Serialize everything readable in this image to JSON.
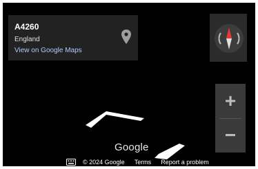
{
  "info_card": {
    "title": "A4260",
    "subtitle": "England",
    "link": "View on Google Maps",
    "pin_icon": "map-pin-icon"
  },
  "compass": {
    "icon": "compass-icon"
  },
  "zoom": {
    "in_label": "+",
    "out_label": "−"
  },
  "logo": {
    "text": "Google"
  },
  "footer": {
    "keyboard_icon": "keyboard-icon",
    "copyright": "© 2024 Google",
    "terms": "Terms",
    "report": "Report a problem"
  },
  "colors": {
    "map_background": "#000000",
    "card_background": "#222222",
    "link": "#aecbfa",
    "compass_north": "#e53935"
  }
}
